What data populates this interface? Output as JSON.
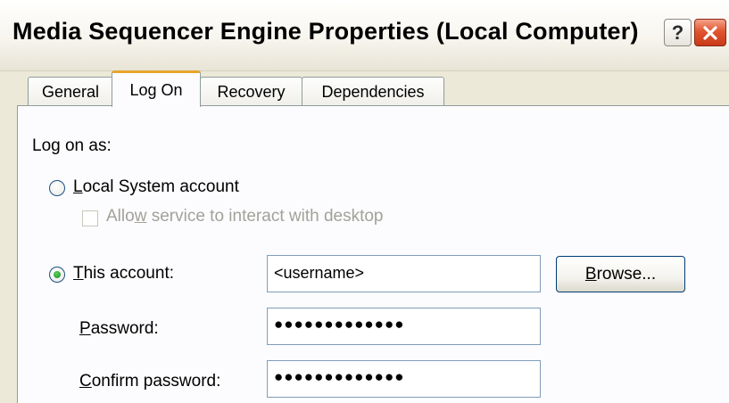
{
  "window": {
    "title": "Media Sequencer Engine Properties (Local Computer)",
    "help_label": "?"
  },
  "tabs": [
    {
      "label": "General",
      "active": false
    },
    {
      "label": "Log On",
      "active": true
    },
    {
      "label": "Recovery",
      "active": false
    },
    {
      "label": "Dependencies",
      "active": false
    }
  ],
  "logon": {
    "heading": "Log on as:",
    "local_system": {
      "label_accel": "L",
      "label_rest": "ocal System account",
      "selected": false
    },
    "allow_interact": {
      "label_pre": "Allo",
      "label_accel": "w",
      "label_rest": " service to interact with desktop",
      "checked": false,
      "enabled": false
    },
    "this_account": {
      "label_accel": "T",
      "label_rest": "his account:",
      "selected": true,
      "value": "<username>"
    },
    "browse_button": {
      "label_accel": "B",
      "label_rest": "rowse..."
    },
    "password": {
      "label_accel": "P",
      "label_rest": "assword:",
      "value": "●●●●●●●●●●●●●"
    },
    "confirm_password": {
      "label_accel": "C",
      "label_rest": "onfirm password:",
      "value": "●●●●●●●●●●●●●"
    }
  }
}
